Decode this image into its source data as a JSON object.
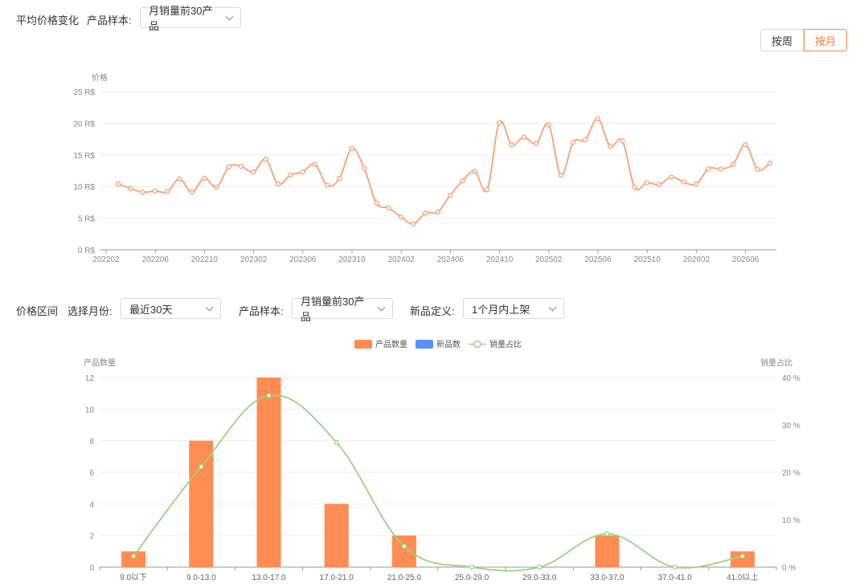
{
  "top": {
    "title": "平均价格变化",
    "sample_label": "产品样本:",
    "sample_value": "月销量前30产品",
    "toggle": {
      "week": "按周",
      "month": "按月",
      "active": "month"
    }
  },
  "bottom": {
    "title": "价格区间",
    "month_label": "选择月份:",
    "month_value": "最近30天",
    "sample_label": "产品样本:",
    "sample_value": "月销量前30产品",
    "new_label": "新品定义:",
    "new_value": "1个月内上架"
  },
  "colors": {
    "line": "#f7a173",
    "bar": "#ff8c52",
    "new": "#5b8ff9",
    "ratio": "#9ad47e",
    "accent": "#ff7a30"
  },
  "chart_data": [
    {
      "type": "line",
      "ylabel": "价格",
      "ylim": [
        0,
        25
      ],
      "yticks": [
        "0 R$",
        "5 R$",
        "10 R$",
        "15 R$",
        "20 R$",
        "25 R$"
      ],
      "xticks": [
        "202202",
        "202206",
        "202210",
        "202302",
        "202306",
        "202310",
        "202402",
        "202406",
        "202410",
        "202502",
        "202506",
        "202510",
        "202602",
        "202606"
      ],
      "values": [
        10.4,
        9.7,
        9.1,
        9.3,
        9.2,
        11.2,
        9.1,
        11.3,
        9.9,
        13.1,
        13.2,
        12.3,
        14.3,
        10.4,
        11.8,
        12.3,
        13.5,
        10.2,
        11.3,
        16.0,
        12.9,
        7.4,
        6.6,
        5.2,
        4.1,
        5.8,
        6.0,
        8.6,
        10.9,
        12.4,
        9.5,
        20.1,
        16.6,
        17.8,
        16.8,
        19.8,
        11.8,
        17.0,
        17.4,
        20.7,
        16.4,
        17.2,
        9.9,
        10.6,
        10.3,
        11.5,
        10.7,
        10.4,
        12.8,
        12.8,
        13.5,
        16.6,
        12.7,
        13.7
      ]
    },
    {
      "type": "bar",
      "categories": [
        "9.0以下",
        "9.0-13.0",
        "13.0-17.0",
        "17.0-21.0",
        "21.0-25.0",
        "25.0-29.0",
        "29.0-33.0",
        "33.0-37.0",
        "37.0-41.0",
        "41.0以上"
      ],
      "ylabel": "产品数量",
      "y2label": "销量占比",
      "ylim": [
        0,
        12
      ],
      "y2lim": [
        0,
        40
      ],
      "yticks": [
        "0",
        "2",
        "4",
        "6",
        "8",
        "10",
        "12"
      ],
      "y2ticks": [
        "0 %",
        "10 %",
        "20 %",
        "30 %",
        "40 %"
      ],
      "legend": [
        "产品数量",
        "新品数",
        "销量占比"
      ],
      "series": [
        {
          "name": "产品数量",
          "values": [
            1,
            8,
            12,
            4,
            2,
            0,
            0,
            2,
            0,
            1
          ]
        },
        {
          "name": "新品数",
          "values": [
            0,
            0,
            0,
            0,
            0,
            0,
            0,
            0,
            0,
            0
          ]
        },
        {
          "name": "销量占比",
          "values": [
            2.3,
            21.2,
            36.2,
            26.3,
            4.4,
            0,
            0,
            7.0,
            0,
            2.3
          ]
        }
      ]
    }
  ]
}
